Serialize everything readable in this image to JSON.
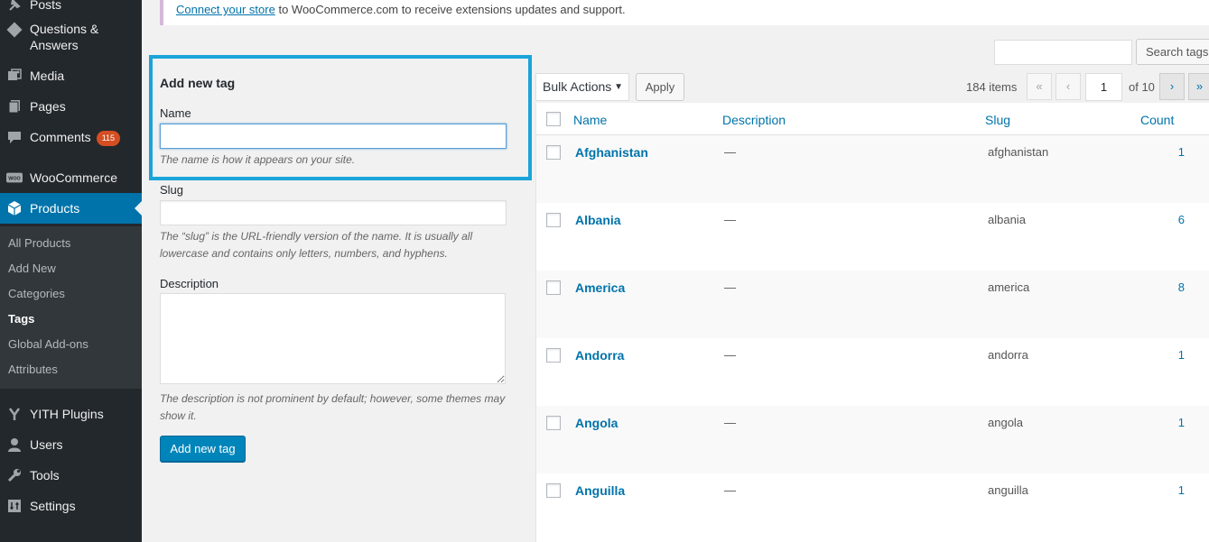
{
  "sidebar": {
    "top_partial": "Posts",
    "items": [
      {
        "label": "Questions & Answers",
        "icon": "questions-icon"
      },
      {
        "label": "Media",
        "icon": "media-icon"
      },
      {
        "label": "Pages",
        "icon": "pages-icon"
      },
      {
        "label": "Comments",
        "icon": "comments-icon",
        "badge": "115"
      },
      {
        "label": "WooCommerce",
        "icon": "woocommerce-icon"
      },
      {
        "label": "Products",
        "icon": "products-icon",
        "current": true
      },
      {
        "label": "YITH Plugins",
        "icon": "yith-icon"
      },
      {
        "label": "Users",
        "icon": "users-icon"
      },
      {
        "label": "Tools",
        "icon": "tools-icon"
      },
      {
        "label": "Settings",
        "icon": "settings-icon"
      }
    ],
    "submenu": [
      "All Products",
      "Add New",
      "Categories",
      "Tags",
      "Global Add-ons",
      "Attributes"
    ],
    "submenu_current": "Tags"
  },
  "notice": {
    "link_text": "Connect your store",
    "text": " to WooCommerce.com to receive extensions updates and support."
  },
  "form": {
    "title": "Add new tag",
    "name_label": "Name",
    "name_value": "",
    "name_hint": "The name is how it appears on your site.",
    "slug_label": "Slug",
    "slug_value": "",
    "slug_hint": "The “slug” is the URL-friendly version of the name. It is usually all lowercase and contains only letters, numbers, and hyphens.",
    "description_label": "Description",
    "description_value": "",
    "description_hint": "The description is not prominent by default; however, some themes may show it.",
    "submit_label": "Add new tag"
  },
  "search": {
    "value": "",
    "button_label": "Search tags"
  },
  "tablenav": {
    "bulk_actions": "Bulk Actions",
    "apply_label": "Apply",
    "items_count": "184 items",
    "first_page": "«",
    "prev_page": "‹",
    "current_page": "1",
    "total_pages": "of 10",
    "next_page": "›",
    "last_page": "»"
  },
  "table": {
    "columns": {
      "name": "Name",
      "description": "Description",
      "slug": "Slug",
      "count": "Count"
    },
    "rows": [
      {
        "name": "Afghanistan",
        "description": "—",
        "slug": "afghanistan",
        "count": "1"
      },
      {
        "name": "Albania",
        "description": "—",
        "slug": "albania",
        "count": "6"
      },
      {
        "name": "America",
        "description": "—",
        "slug": "america",
        "count": "8"
      },
      {
        "name": "Andorra",
        "description": "—",
        "slug": "andorra",
        "count": "1"
      },
      {
        "name": "Angola",
        "description": "—",
        "slug": "angola",
        "count": "1"
      },
      {
        "name": "Anguilla",
        "description": "—",
        "slug": "anguilla",
        "count": "1"
      }
    ]
  },
  "colors": {
    "accent": "#0073aa",
    "highlight": "#1aa4d8",
    "sidebar_bg": "#23282d",
    "badge": "#d54e21"
  }
}
